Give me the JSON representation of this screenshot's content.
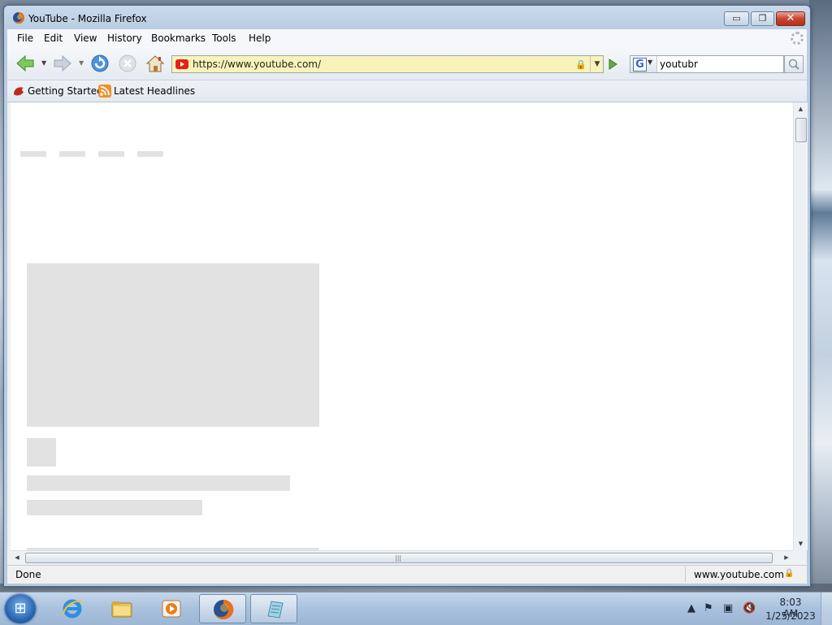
{
  "window": {
    "title": "YouTube - Mozilla Firefox",
    "minimize": "▭",
    "maximize": "❐",
    "close": "✕"
  },
  "menubar": {
    "items": [
      {
        "label": "File"
      },
      {
        "label": "Edit"
      },
      {
        "label": "View"
      },
      {
        "label": "History"
      },
      {
        "label": "Bookmarks"
      },
      {
        "label": "Tools"
      },
      {
        "label": "Help"
      }
    ]
  },
  "navigation": {
    "back_icon": "back-arrow-icon",
    "forward_icon": "forward-arrow-icon",
    "reload_icon": "reload-icon",
    "stop_icon": "stop-icon",
    "home_icon": "home-icon",
    "url": "https://www.youtube.com/",
    "search_engine": "G",
    "search_text": "youtubr"
  },
  "bookmarks": {
    "items": [
      {
        "label": "Getting Started",
        "icon": "firefox-bookmark-icon"
      },
      {
        "label": "Latest Headlines",
        "icon": "rss-icon"
      }
    ]
  },
  "status": {
    "text": "Done",
    "site": "www.youtube.com"
  },
  "taskbar": {
    "time": "8:03 AM",
    "date": "1/25/2023",
    "apps": [
      {
        "name": "internet-explorer-icon"
      },
      {
        "name": "file-explorer-icon"
      },
      {
        "name": "media-player-icon"
      },
      {
        "name": "firefox-icon"
      },
      {
        "name": "notepad-icon"
      }
    ]
  },
  "colors": {
    "urlbar_bg": "#f8f3b8",
    "skeleton": "#e2e2e2",
    "youtube_red": "#e62117"
  }
}
